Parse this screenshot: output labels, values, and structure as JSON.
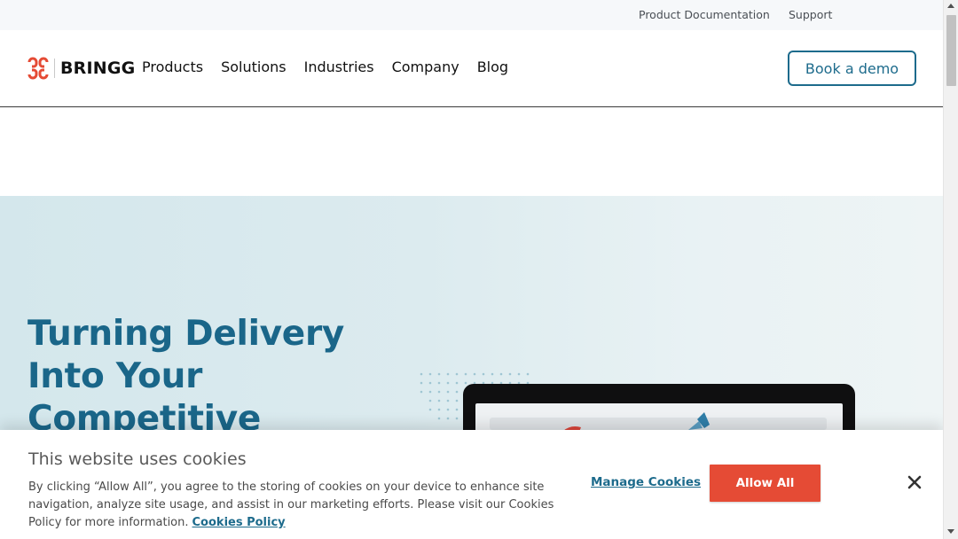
{
  "utility_bar": {
    "product_documentation": "Product Documentation",
    "support": "Support"
  },
  "nav": {
    "logo_text": "BRINGG",
    "items": [
      "Products",
      "Solutions",
      "Industries",
      "Company",
      "Blog"
    ],
    "book_demo": "Book a demo"
  },
  "hero": {
    "title": "Turning Delivery Into Your Competitive"
  },
  "cookie_banner": {
    "title": "This website uses cookies",
    "body": "By clicking “Allow All”, you agree to the storing of cookies on your device to enhance site navigation, analyze site usage, and assist in our marketing efforts. Please visit our Cookies Policy for more information.",
    "policy_link": "Cookies Policy",
    "manage_cookies": "Manage Cookies",
    "allow_all": "Allow All"
  },
  "colors": {
    "brand_blue": "#1d6b8c",
    "accent_red": "#e54b35",
    "hero_bg": "#d4e7ec"
  },
  "icons": {
    "logo_mark": "bringg-logo-icon",
    "close": "close-icon"
  }
}
